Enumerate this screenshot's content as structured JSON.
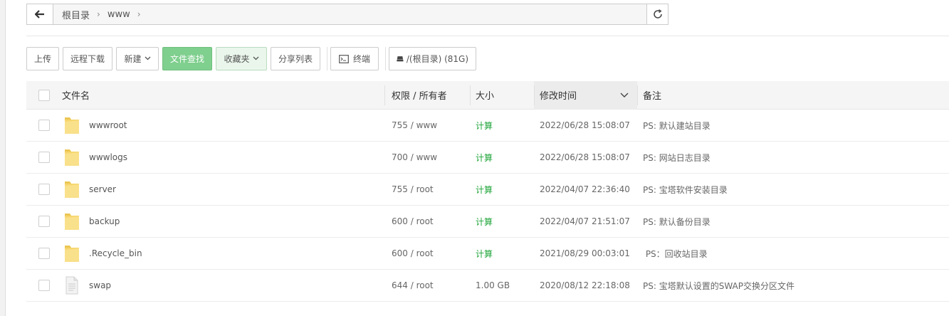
{
  "path": {
    "crumbs": [
      "根目录",
      "www"
    ]
  },
  "toolbar": {
    "upload": "上传",
    "remote_download": "远程下载",
    "new": "新建",
    "file_search": "文件查找",
    "favorites": "收藏夹",
    "share_list": "分享列表",
    "terminal": "终端",
    "disk": "/(根目录) (81G)"
  },
  "table": {
    "headers": {
      "name": "文件名",
      "perm": "权限 / 所有者",
      "size": "大小",
      "mtime": "修改时间",
      "note": "备注"
    },
    "rows": [
      {
        "name": "wwwroot",
        "type": "folder",
        "perm": "755 / www",
        "size": "计算",
        "mtime": "2022/06/28 15:08:07",
        "note": "PS: 默认建站目录"
      },
      {
        "name": "wwwlogs",
        "type": "folder",
        "perm": "700 / www",
        "size": "计算",
        "mtime": "2022/06/28 15:08:07",
        "note": "PS: 网站日志目录"
      },
      {
        "name": "server",
        "type": "folder",
        "perm": "755 / root",
        "size": "计算",
        "mtime": "2022/04/07 22:36:40",
        "note": "PS: 宝塔软件安装目录"
      },
      {
        "name": "backup",
        "type": "folder",
        "perm": "600 / root",
        "size": "计算",
        "mtime": "2022/04/07 21:51:07",
        "note": "PS: 默认备份目录"
      },
      {
        "name": ".Recycle_bin",
        "type": "folder",
        "perm": "600 / root",
        "size": "计算",
        "mtime": "2021/08/29 00:03:01",
        "note": " PS：回收站目录"
      },
      {
        "name": "swap",
        "type": "file",
        "perm": "644 / root",
        "size": "1.00 GB",
        "mtime": "2020/08/12 22:18:08",
        "note": "PS: 宝塔默认设置的SWAP交换分区文件"
      }
    ]
  },
  "colors": {
    "accent_green": "#20a53a",
    "button_green": "#7fcf8e",
    "folder_yellow": "#f7d56b"
  }
}
